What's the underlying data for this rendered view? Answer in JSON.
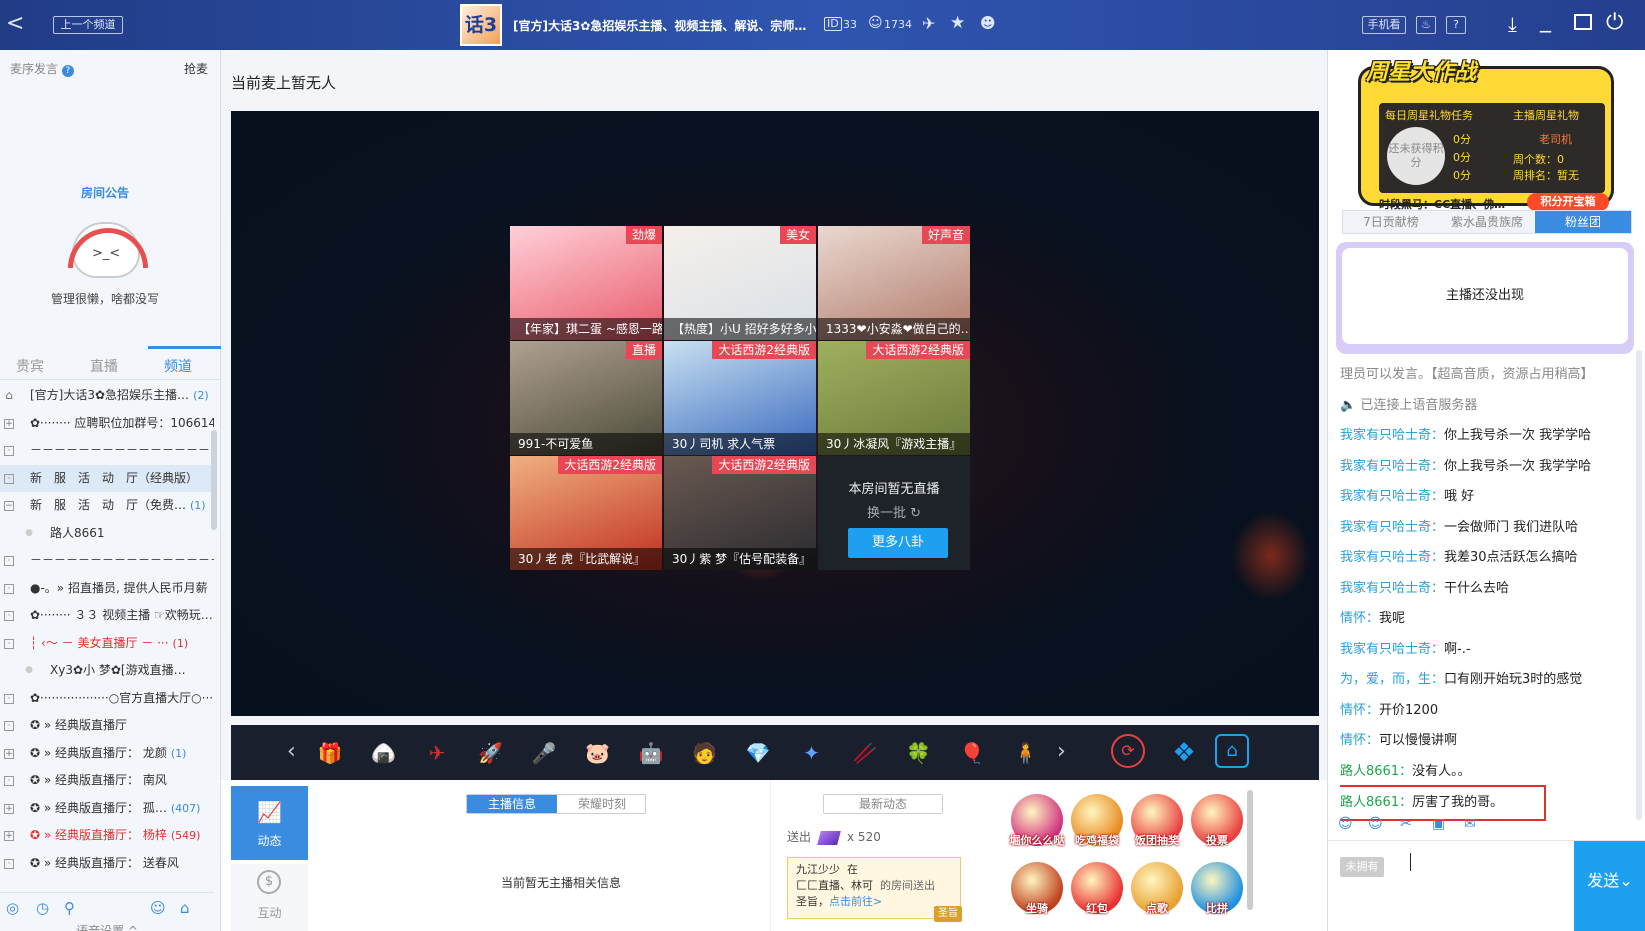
{
  "topbar": {
    "back_label": "<",
    "prev_channel": "上一个频道",
    "logo_text": "话3",
    "title": "[官方]大话3✿急招娱乐主播、视频主播、解说、宗师…",
    "id_value": "33",
    "user_count": "1734",
    "mobile_view": "手机看",
    "help": "?"
  },
  "left": {
    "mic_label": "麦序发言",
    "grab_label": "抢麦",
    "notice_title": "房间公告",
    "notice_text": "管理很懒，啥都没写",
    "tabs": [
      "贵宾",
      "直播",
      "频道"
    ],
    "channels": [
      {
        "text": "[官方]大话3✿急招娱乐主播…",
        "count": "(2)",
        "style": "house"
      },
      {
        "text": "✿········ 应聘职位加群号：1066140…",
        "count": "",
        "style": "plus"
      },
      {
        "text": "－－－－－－－－－－－－－－－－－－－－",
        "count": "",
        "style": "box"
      },
      {
        "text": "新　服　活　动　厅（经典版）",
        "count": "",
        "style": "hl"
      },
      {
        "text": "新　服　活　动　厅（免费…",
        "count": "(1)",
        "style": "minus"
      },
      {
        "text": "路人8661",
        "count": "",
        "style": "user"
      },
      {
        "text": "－－－－－－－－－－－－－－－－－－－－",
        "count": "",
        "style": "box"
      },
      {
        "text": "●-。» 招直播员, 提供人民币月薪",
        "count": "",
        "style": "box"
      },
      {
        "text": "✿········ ３３ 视频主播 ☞欢畅玩…",
        "count": "",
        "style": "box"
      },
      {
        "text": "┆ ‹～ － 美女直播厅 － ···",
        "count": "(1)",
        "style": "red"
      },
      {
        "text": "Xy3✿小 梦✿[游戏直播…",
        "count": "",
        "style": "user2"
      },
      {
        "text": "✿··················○官方直播大厅○·········",
        "count": "",
        "style": "box"
      },
      {
        "text": "✪ » 经典版直播厅",
        "count": "",
        "style": "box"
      },
      {
        "text": "✪ » 经典版直播厅： 龙颜",
        "count": "(1)",
        "style": "plus"
      },
      {
        "text": "✪ » 经典版直播厅： 南风",
        "count": "",
        "style": "box"
      },
      {
        "text": "✪ » 经典版直播厅： 孤…",
        "count": "(407)",
        "style": "plus"
      },
      {
        "text": "✪ » 经典版直播厅： 杨梓",
        "count": "(549)",
        "style": "redplus"
      },
      {
        "text": "✪ » 经典版直播厅： 送春风",
        "count": "",
        "style": "box"
      }
    ],
    "voice_settings": "语音设置 ^"
  },
  "center": {
    "mic_status": "当前麦上暂无人",
    "tiles": [
      {
        "label": "【年家】琪二蛋 ~感恩一路…",
        "tag": "劲爆",
        "color1": "#e85a6a",
        "color2": "#ffd0d8"
      },
      {
        "label": "【热度】小U 招好多好多小…",
        "tag": "美女",
        "color1": "#d8e0e8",
        "color2": "#f6f0ea"
      },
      {
        "label": "1333❤小安淼❤做自己的…",
        "tag": "好声音",
        "color1": "#b07a6a",
        "color2": "#ead8d0"
      },
      {
        "label": "991-不可爱鱼",
        "tag": "直播",
        "color1": "#4a4a3a",
        "color2": "#b0a090"
      },
      {
        "label": "30丿司机 求人气票",
        "tag": "大话西游2经典版",
        "color1": "#3a6ac0",
        "color2": "#c8e0f0"
      },
      {
        "label": "30丿冰凝风『游戏主播』",
        "tag": "大话西游2经典版",
        "color1": "#6a7a3a",
        "color2": "#a0b060"
      },
      {
        "label": "30丿老 虎『比武解说』",
        "tag": "大话西游2经典版",
        "color1": "#c03020",
        "color2": "#f0b080"
      },
      {
        "label": "30丿紫 梦『估号配装备』",
        "tag": "大话西游2经典版",
        "color1": "#2a2a30",
        "color2": "#6a5a50"
      }
    ],
    "empty_title": "本房间暂无直播",
    "refresh_label": "换一批 ↻",
    "more_button": "更多八卦",
    "gifts": [
      "🎁",
      "🍙",
      "✈",
      "🚀",
      "🎤",
      "🐷",
      "🤖",
      "🧑",
      "💎",
      "✦",
      "🥢",
      "🍀",
      "🎈",
      "🧍"
    ],
    "bottom": {
      "tab_dynamic": "动态",
      "tab_interact": "互动",
      "subtab_anchor": "主播信息",
      "subtab_glory": "荣耀时刻",
      "no_anchor_info": "当前暂无主播相关信息",
      "latest_header": "最新动态",
      "sent_label": "送出",
      "sent_count": "x 520",
      "notice_user": "九江少少",
      "notice_in": "在",
      "notice_room": "匚匚直播、林可",
      "notice_room_suffix": "的房间送出",
      "notice_gift": "圣旨，",
      "notice_link": "点击前往>",
      "notice_badge": "圣旨"
    },
    "right_gifts": [
      {
        "label": "堀你么么哒",
        "c": "#d03080"
      },
      {
        "label": "吃鸡福袋",
        "c": "#e88a20"
      },
      {
        "label": "饭团抽奖",
        "c": "#e84040"
      },
      {
        "label": "投票",
        "c": "#e84040"
      },
      {
        "label": "坐骑",
        "c": "#c04020"
      },
      {
        "label": "红包",
        "c": "#e83030"
      },
      {
        "label": "点歌",
        "c": "#e8a030"
      },
      {
        "label": "比拼",
        "c": "#1e90e0"
      }
    ]
  },
  "right": {
    "banner_title": "周星大作战",
    "daily_task": "每日周星礼物任务",
    "anchor_gift": "主播周星礼物",
    "no_points": "还未获得积分",
    "scores": [
      "0分",
      "0分",
      "0分"
    ],
    "anchor_name": "老司机",
    "week_count": "周个数：0",
    "week_rank": "周排名：暂无",
    "dark_horse": "时段黑马：CC直播、佛…",
    "open_chest": "积分开宝箱",
    "tabs": [
      "7日贡献榜",
      "紫水晶贵族席",
      "粉丝团"
    ],
    "anchor_absent": "主播还没出现",
    "chat": [
      {
        "u": "",
        "t": "理员可以发言。【超高音质，资源占用稍高】",
        "type": "sys"
      },
      {
        "u": "",
        "t": "🔈 已连接上语音服务器",
        "type": "sys"
      },
      {
        "u": "我家有只哈士奇：",
        "t": "你上我号杀一次 我学学哈",
        "type": ""
      },
      {
        "u": "我家有只哈士奇：",
        "t": "你上我号杀一次 我学学哈",
        "type": ""
      },
      {
        "u": "我家有只哈士奇：",
        "t": "哦 好",
        "type": ""
      },
      {
        "u": "我家有只哈士奇：",
        "t": "一会做师门 我们进队哈",
        "type": ""
      },
      {
        "u": "我家有只哈士奇：",
        "t": "我差30点活跃怎么搞哈",
        "type": ""
      },
      {
        "u": "我家有只哈士奇：",
        "t": "干什么去哈",
        "type": ""
      },
      {
        "u": "情怀：",
        "t": "我呢",
        "type": ""
      },
      {
        "u": "我家有只哈士奇：",
        "t": "啊-.-",
        "type": ""
      },
      {
        "u": "为，爱，而，生：",
        "t": "口有刚开始玩3时的感觉",
        "type": ""
      },
      {
        "u": "情怀：",
        "t": "开价1200",
        "type": ""
      },
      {
        "u": "情怀：",
        "t": "可以慢慢讲啊",
        "type": ""
      },
      {
        "u": "路人8661：",
        "t": "没有人。。",
        "type": "green"
      },
      {
        "u": "路人8661：",
        "t": "厉害了我的哥。",
        "type": "green boxed"
      }
    ],
    "no_have": "未拥有",
    "send": "发送⌄"
  }
}
